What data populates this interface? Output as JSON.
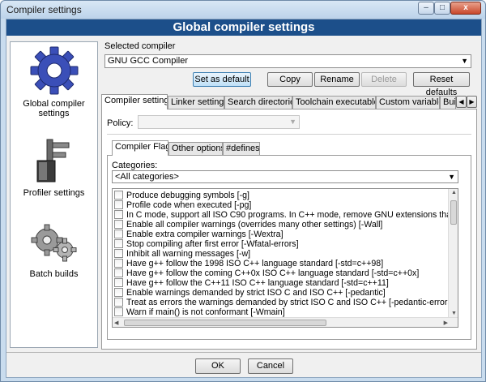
{
  "window": {
    "title": "Compiler settings",
    "controls": {
      "minimize": "–",
      "maximize": "□",
      "close": "x"
    }
  },
  "header": {
    "title": "Global compiler settings"
  },
  "sidebar": {
    "items": [
      {
        "label": "Global compiler settings",
        "icon": "gear-icon"
      },
      {
        "label": "Profiler settings",
        "icon": "caliper-icon"
      },
      {
        "label": "Batch builds",
        "icon": "gears-icon"
      }
    ]
  },
  "compiler": {
    "label": "Selected compiler",
    "selected": "GNU GCC Compiler",
    "buttons": {
      "set_default": "Set as default",
      "copy": "Copy",
      "rename": "Rename",
      "delete": "Delete",
      "reset": "Reset defaults"
    }
  },
  "tabs": [
    "Compiler settings",
    "Linker settings",
    "Search directories",
    "Toolchain executables",
    "Custom variables",
    "Bui"
  ],
  "policy": {
    "label": "Policy:",
    "value": ""
  },
  "subtabs": [
    "Compiler Flags",
    "Other options",
    "#defines"
  ],
  "categories": {
    "label": "Categories:",
    "selected": "<All categories>"
  },
  "flags": [
    "Produce debugging symbols  [-g]",
    "Profile code when executed  [-pg]",
    "In C mode, support all ISO C90 programs. In C++ mode, remove GNU extensions that conflic",
    "Enable all compiler warnings (overrides many other settings)  [-Wall]",
    "Enable extra compiler warnings  [-Wextra]",
    "Stop compiling after first error  [-Wfatal-errors]",
    "Inhibit all warning messages  [-w]",
    "Have g++ follow the 1998 ISO C++ language standard  [-std=c++98]",
    "Have g++ follow the coming C++0x ISO C++ language standard  [-std=c++0x]",
    "Have g++ follow the C++11 ISO C++ language standard  [-std=c++11]",
    "Enable warnings demanded by strict ISO C and ISO C++  [-pedantic]",
    "Treat as errors the warnings demanded by strict ISO C and ISO C++  [-pedantic-errors]",
    "Warn if main() is not conformant  [-Wmain]"
  ],
  "dialog": {
    "ok": "OK",
    "cancel": "Cancel"
  },
  "colors": {
    "header_bg": "#1c4f8a",
    "window_frame": "#c9dcee"
  }
}
